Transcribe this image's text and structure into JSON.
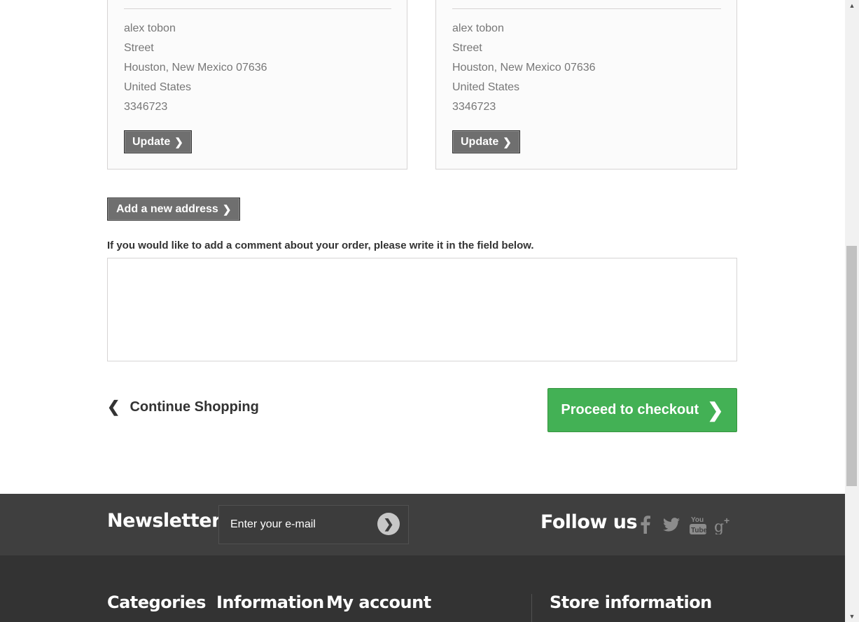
{
  "addresses": [
    {
      "name": "alex tobon",
      "street": "Street",
      "city_line": "Houston, New Mexico 07636",
      "country": "United States",
      "phone": "3346723",
      "update_label": "Update"
    },
    {
      "name": "alex tobon",
      "street": "Street",
      "city_line": "Houston, New Mexico 07636",
      "country": "United States",
      "phone": "3346723",
      "update_label": "Update"
    }
  ],
  "add_address_label": "Add a new address",
  "comment": {
    "label": "If you would like to add a comment about your order, please write it in the field below.",
    "value": ""
  },
  "continue_shopping_label": "Continue Shopping",
  "checkout_label": "Proceed to checkout",
  "newsletter": {
    "title": "Newsletter",
    "placeholder": "Enter your e-mail"
  },
  "follow": {
    "title": "Follow us",
    "icons": [
      "facebook-icon",
      "twitter-icon",
      "youtube-icon",
      "google-plus-icon"
    ]
  },
  "footer": {
    "categories": "Categories",
    "information": "Information",
    "my_account": "My account",
    "store_information": "Store information"
  },
  "colors": {
    "checkout_green": "#43b155",
    "footer_dark": "#333333",
    "newsletter_bar": "#3f3f3f"
  }
}
